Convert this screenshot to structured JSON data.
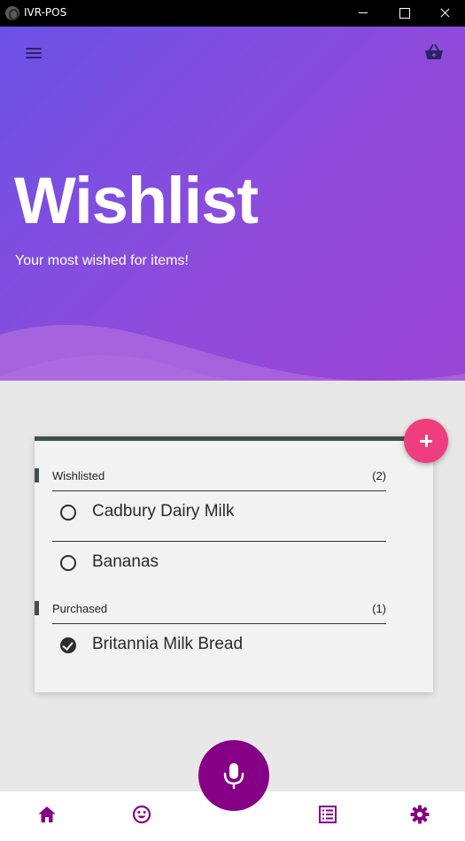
{
  "window": {
    "title": "IVR-POS"
  },
  "header": {
    "title": "Wishlist",
    "subtitle": "Your most wished for items!"
  },
  "icons": {
    "menu": "menu-icon",
    "basket": "basket-icon",
    "add": "plus-icon",
    "mic": "microphone-icon",
    "home": "home-icon",
    "smiley": "smiley-icon",
    "list": "list-icon",
    "settings": "gear-icon"
  },
  "colors": {
    "header_gradient_start": "#6a52e6",
    "header_gradient_end": "#9a45d6",
    "accent_pink": "#ef3e7d",
    "primary_purple": "#850085",
    "card_border": "#3f4f4f"
  },
  "wishlist": {
    "sections": [
      {
        "label": "Wishlisted",
        "count": "(2)",
        "items": [
          {
            "name": "Cadbury Dairy Milk",
            "purchased": false
          },
          {
            "name": "Bananas",
            "purchased": false
          }
        ]
      },
      {
        "label": "Purchased",
        "count": "(1)",
        "items": [
          {
            "name": "Britannia Milk Bread",
            "purchased": true
          }
        ]
      }
    ]
  }
}
